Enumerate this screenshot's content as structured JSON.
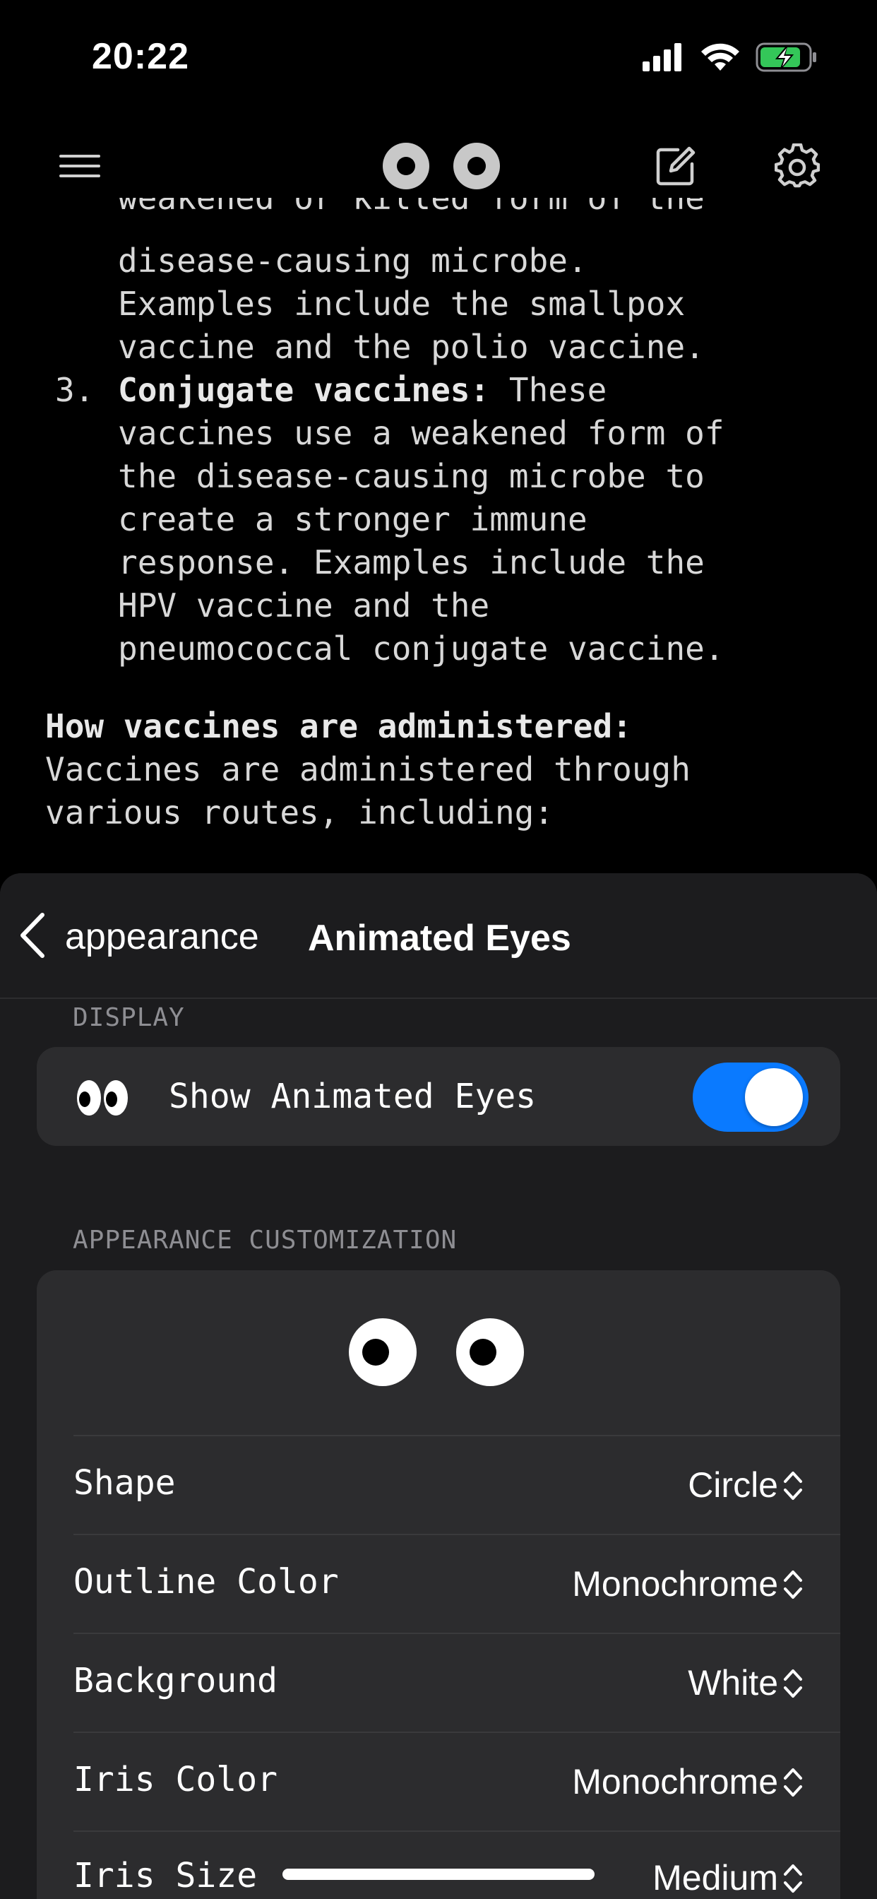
{
  "status_bar": {
    "time": "20:22"
  },
  "nav": {
    "menu_icon": "hamburger-menu-icon",
    "logo_icon": "eyes-logo-icon",
    "compose_icon": "compose-icon",
    "settings_icon": "gear-icon"
  },
  "chat": {
    "line_partial": "weakened or killed form of the",
    "item2_lines": [
      "disease-causing microbe.",
      "Examples include the smallpox",
      "vaccine and the polio vaccine."
    ],
    "item3_number": "3.",
    "item3_bold": "Conjugate vaccines:",
    "item3_rest": " These",
    "item3_lines": [
      "vaccines use a weakened form of",
      "the disease-causing microbe to",
      "create a stronger immune",
      "response. Examples include the",
      "HPV vaccine and the",
      "pneumococcal conjugate vaccine."
    ],
    "heading": "How vaccines are administered:",
    "para_lines": [
      "Vaccines are administered through",
      "various routes, including:"
    ]
  },
  "sheet": {
    "back_label": "appearance",
    "title": "Animated Eyes",
    "display_section": "DISPLAY",
    "show_eyes_label": "Show Animated Eyes",
    "show_eyes_enabled": true,
    "customization_section": "APPEARANCE CUSTOMIZATION",
    "rows": [
      {
        "label": "Shape",
        "value": "Circle"
      },
      {
        "label": "Outline Color",
        "value": "Monochrome"
      },
      {
        "label": "Background",
        "value": "White"
      },
      {
        "label": "Iris Color",
        "value": "Monochrome"
      },
      {
        "label": "Iris Size",
        "value": "Medium"
      }
    ]
  },
  "colors": {
    "accent": "#0a7aff",
    "sheet_bg": "#1c1c1e",
    "card_bg": "#2c2c2e",
    "battery": "#34c759"
  }
}
